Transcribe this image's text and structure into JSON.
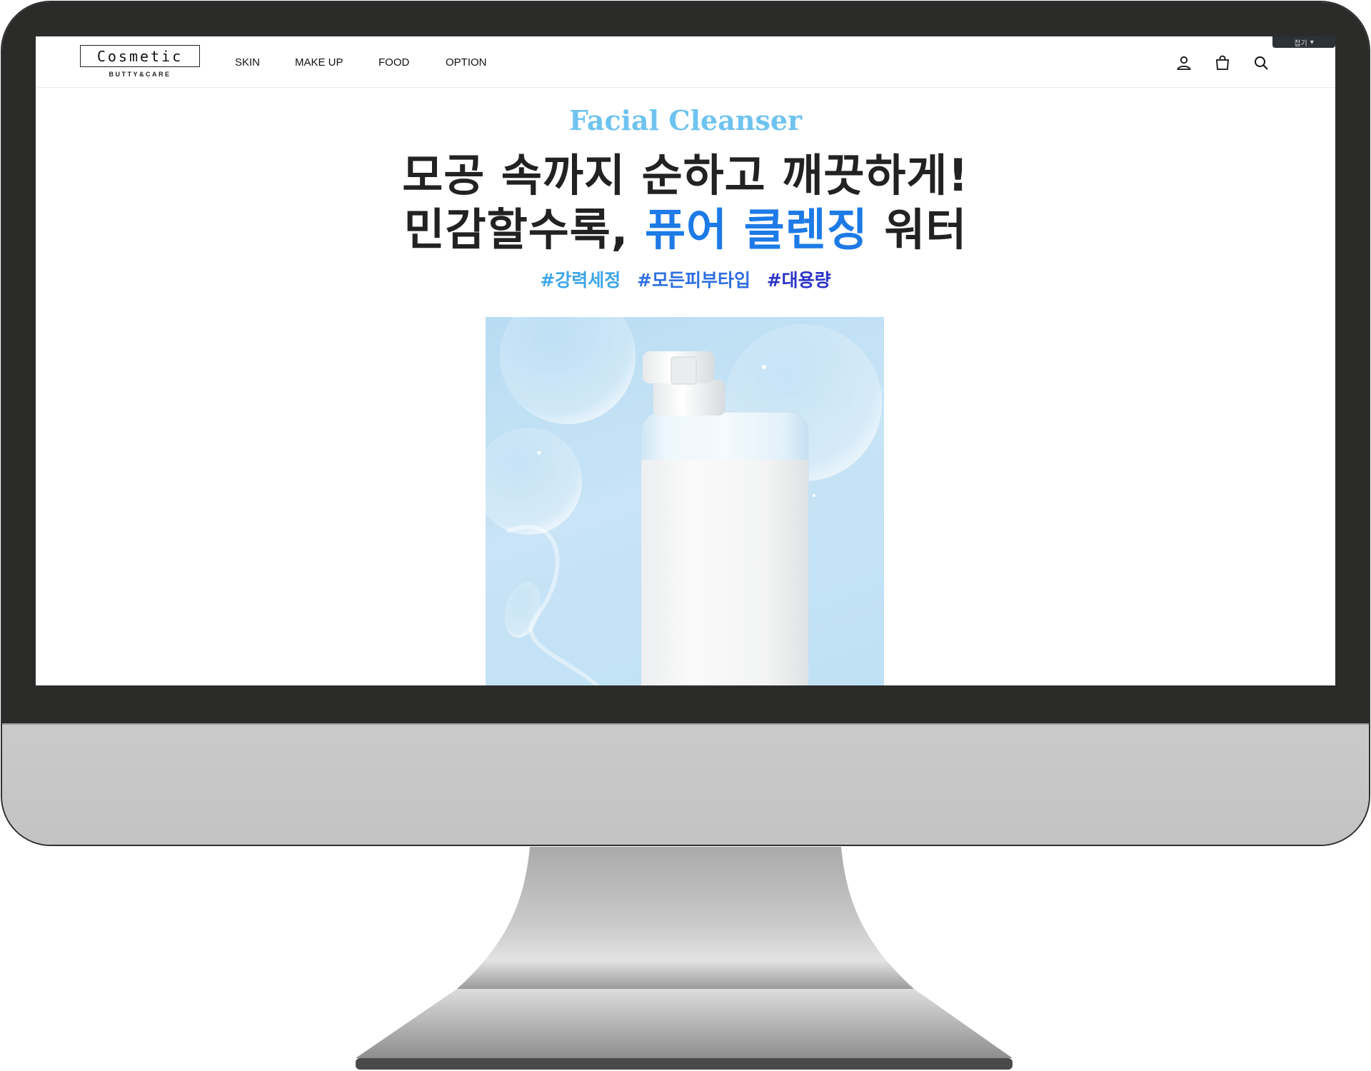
{
  "brand": {
    "name": "Cosmetic",
    "tagline": "BUTTY&CARE"
  },
  "nav": {
    "items": [
      {
        "label": "SKIN"
      },
      {
        "label": "MAKE UP"
      },
      {
        "label": "FOOD"
      },
      {
        "label": "OPTION"
      }
    ]
  },
  "header_icons": [
    "user-icon",
    "shopping-bag-icon",
    "search-icon"
  ],
  "lang_tab": {
    "label": "접기"
  },
  "promo": {
    "eyebrow": "Facial Cleanser",
    "headline_line1": "모공 속까지 순하고 깨끗하게!",
    "headline_line2_prefix": "민감할수록, ",
    "headline_line2_highlight": "퓨어 클렌징",
    "headline_line2_suffix": " 워터",
    "tags": [
      {
        "text": "#강력세정",
        "color": "#3ea6e8"
      },
      {
        "text": "#모든피부타입",
        "color": "#2f6fe0"
      },
      {
        "text": "#대용량",
        "color": "#2a32c8"
      }
    ]
  },
  "colors": {
    "accent_blue": "#1d7ae6",
    "eyebrow_blue": "#6fc3ef",
    "bezel": "#2b2b2a",
    "chin": "#c4c5c4"
  }
}
